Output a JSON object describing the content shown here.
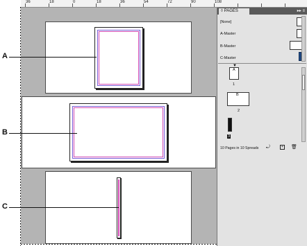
{
  "ruler": {
    "labels": [
      "36",
      "18",
      "0",
      "18",
      "36",
      "54",
      "72",
      "90",
      "108"
    ]
  },
  "callouts": {
    "a": "A",
    "b": "B",
    "c": "C"
  },
  "pages_panel": {
    "tab_label": "◊ PAGES",
    "menu_glyph": "▸▸ ≡",
    "masters": [
      {
        "label": "[None]"
      },
      {
        "label": "A-Master"
      },
      {
        "label": "B-Master"
      },
      {
        "label": "C-Master"
      }
    ],
    "pages": [
      {
        "letter": "A",
        "number": "1"
      },
      {
        "letter": "B",
        "number": "2"
      },
      {
        "letter": "C",
        "number": "3"
      }
    ],
    "status": "10 Pages in 10 Spreads",
    "icons": [
      "page-size-icon",
      "new-page-icon",
      "delete-page-icon"
    ]
  }
}
